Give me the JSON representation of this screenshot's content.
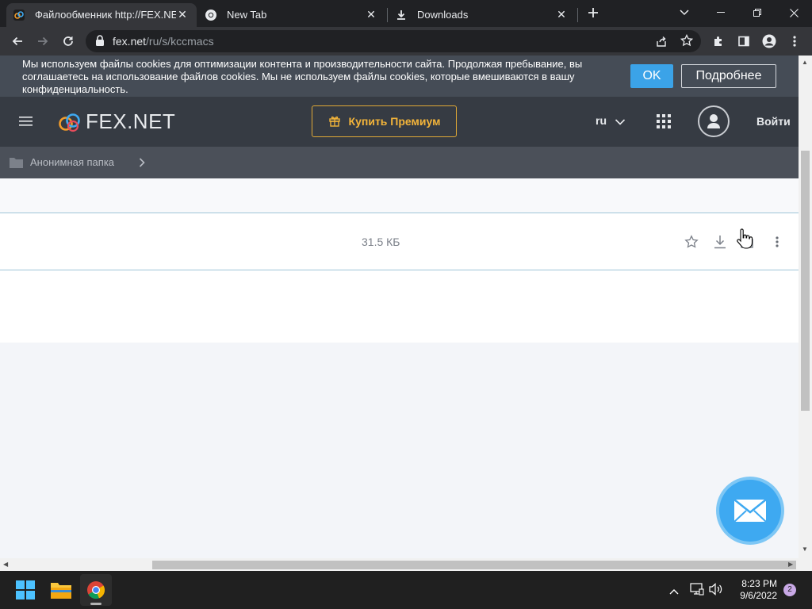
{
  "browser": {
    "tabs": [
      {
        "title": "Файлообменник http://FEX.NET",
        "active": true,
        "icon": "fex-favicon-icon"
      },
      {
        "title": "New Tab",
        "active": false,
        "icon": "chrome-icon"
      },
      {
        "title": "Downloads",
        "active": false,
        "icon": "download-icon"
      }
    ],
    "url_host": "fex.net",
    "url_path": "/ru/s/kccmacs"
  },
  "cookie_banner": {
    "text": "Мы используем файлы cookies для оптимизации контента и производительности сайта. Продолжая пребывание, вы соглашаетесь на использование файлов cookies. Мы не используем файлы cookies, которые вмешиваются в вашу конфиденциальность.",
    "ok_label": "OK",
    "more_label": "Подробнее"
  },
  "site": {
    "logo_text": "FEX.NET",
    "premium_label": "Купить Премиум",
    "language": "ru",
    "login_label": "Войти"
  },
  "breadcrumb": {
    "folder_label": "Анонимная папка"
  },
  "file": {
    "size": "31.5 КБ"
  },
  "taskbar": {
    "time": "8:23 PM",
    "date": "9/6/2022",
    "notifications": "2"
  },
  "colors": {
    "accent_blue": "#3ba3e8",
    "premium_gold": "#f3b43a",
    "header_dark": "#363b43"
  }
}
